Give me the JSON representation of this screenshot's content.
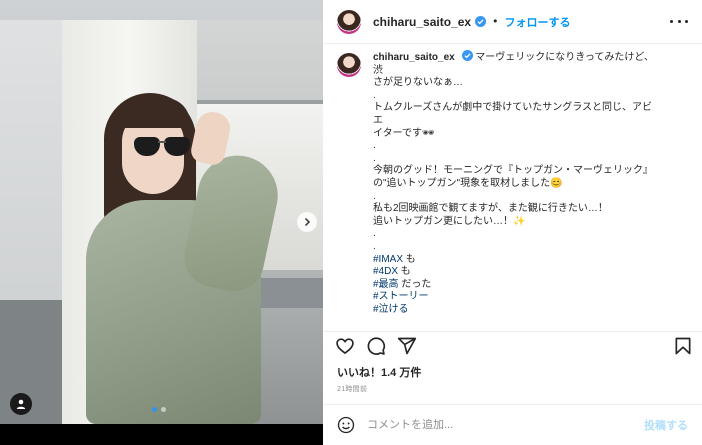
{
  "post": {
    "username": "chiharu_saito_ex",
    "follow_label": "フォローする",
    "separator": "•",
    "image_alt": "post photo"
  },
  "caption": {
    "username": "chiharu_saito_ex",
    "lines": [
      "マーヴェリックになりきってみたけど、渋",
      "さが足りないなぁ…",
      ".",
      "トムクルーズさんが劇中で掛けていたサングラスと同じ、アビエ",
      "イターです🕶",
      ".",
      ".",
      "今朝のグッド！モーニングで『トップガン・マーヴェリック』",
      "の\"追いトップガン\"現象を取材しました😊",
      ".",
      "私も2回映画館で観てますが、また観に行きたい…！",
      "追いトップガン更にしたい…！✨",
      ".",
      "."
    ],
    "hashtags": [
      {
        "tag": "#IMAX",
        "suffix": " も"
      },
      {
        "tag": "#4DX",
        "suffix": " も"
      },
      {
        "tag": "#最高",
        "suffix": " だった"
      },
      {
        "tag": "#ストーリー",
        "suffix": ""
      },
      {
        "tag": "#泣ける",
        "suffix": ""
      }
    ]
  },
  "engagement": {
    "likes": "いいね！1.4 万件",
    "time": "21時間前"
  },
  "comment": {
    "placeholder": "コメントを追加...",
    "post_label": "投稿する"
  },
  "icons": {
    "header": [
      "avatar",
      "verified-badge-icon",
      "more-options-icon"
    ],
    "photo": [
      "next-arrow-icon",
      "user-tag-icon"
    ],
    "actions": [
      "heart-icon",
      "comment-icon",
      "share-icon",
      "bookmark-icon"
    ],
    "comment": [
      "emoji-icon"
    ]
  },
  "colors": {
    "link_blue": "#0095f6",
    "hashtag": "#00376b",
    "muted": "#8e8e8e",
    "verified": "#3897f0"
  }
}
